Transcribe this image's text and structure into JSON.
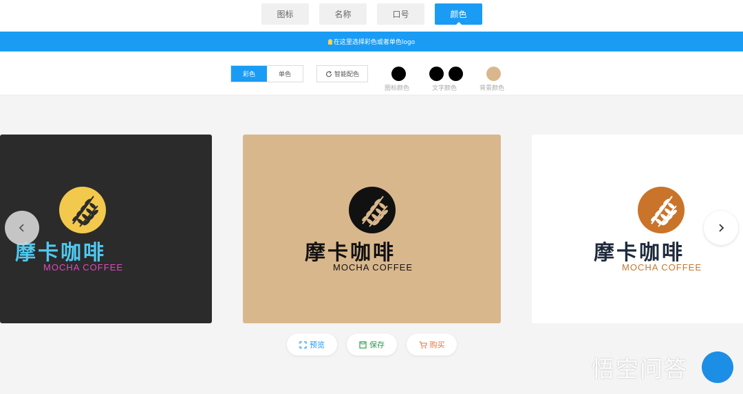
{
  "tabs": [
    {
      "label": "图标",
      "active": false
    },
    {
      "label": "名称",
      "active": false
    },
    {
      "label": "口号",
      "active": false
    },
    {
      "label": "颜色",
      "active": true
    }
  ],
  "hint": "在这里选择彩色或者单色logo",
  "options": {
    "color_label": "彩色",
    "mono_label": "单色",
    "smart_label": "智能配色",
    "icon_color_label": "图标颜色",
    "text_color_label": "文字颜色",
    "bg_color_label": "背景颜色"
  },
  "swatches": {
    "icon": "#000000",
    "text": [
      "#000000",
      "#000000"
    ],
    "background": "#d9b78d"
  },
  "cards": [
    {
      "cn": "摩卡咖啡",
      "en": "MOCHA COFFEE",
      "bg": "#2b2b2b",
      "emblem": "#f2c94c",
      "leaf": "#2b2b2b",
      "cn_color": "#4fc9f0",
      "en_color": "#e04ac0"
    },
    {
      "cn": "摩卡咖啡",
      "en": "MOCHA COFFEE",
      "bg": "#d9b78d",
      "emblem": "#111111",
      "leaf": "#d9b78d",
      "cn_color": "#111111",
      "en_color": "#111111"
    },
    {
      "cn": "摩卡咖啡",
      "en": "MOCHA COFFEE",
      "bg": "#ffffff",
      "emblem": "#c9742a",
      "leaf": "#ffffff",
      "cn_color": "#1e2a3a",
      "en_color": "#c9742a"
    }
  ],
  "actions": {
    "preview": "预览",
    "save": "保存",
    "buy": "购买"
  },
  "watermark": "悟空问答"
}
